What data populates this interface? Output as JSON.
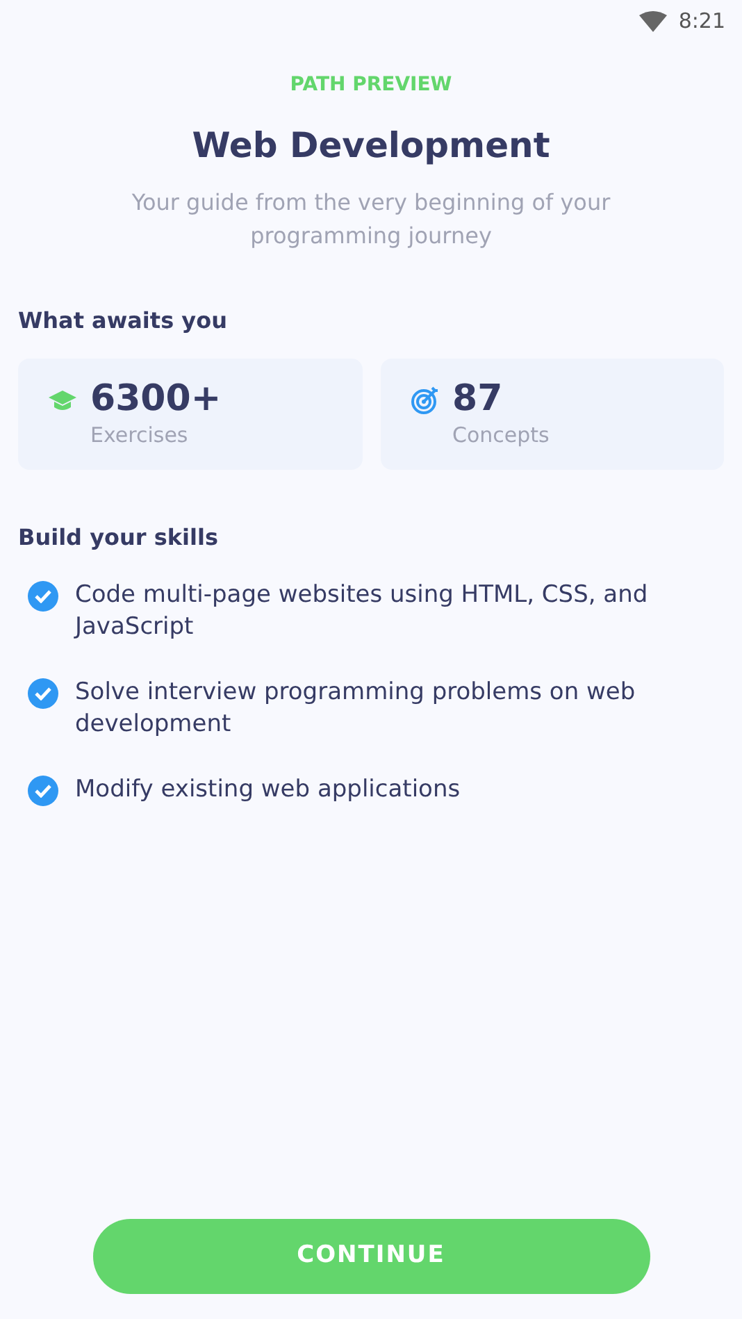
{
  "status_bar": {
    "time": "8:21"
  },
  "eyebrow": "PATH PREVIEW",
  "title": "Web Development",
  "subtitle": "Your guide from the very beginning of your programming journey",
  "stats_heading": "What awaits you",
  "stats": [
    {
      "kind": "exercises",
      "value": "6300+",
      "label": "Exercises"
    },
    {
      "kind": "concepts",
      "value": "87",
      "label": "Concepts"
    }
  ],
  "skills_heading": "Build your skills",
  "skills": [
    {
      "text": "Code multi-page websites using HTML, CSS, and JavaScript",
      "checked": true
    },
    {
      "text": "Solve interview programming problems on web development",
      "checked": true
    },
    {
      "text": "Modify existing web applications",
      "checked": true
    }
  ],
  "button": "CONTINUE"
}
